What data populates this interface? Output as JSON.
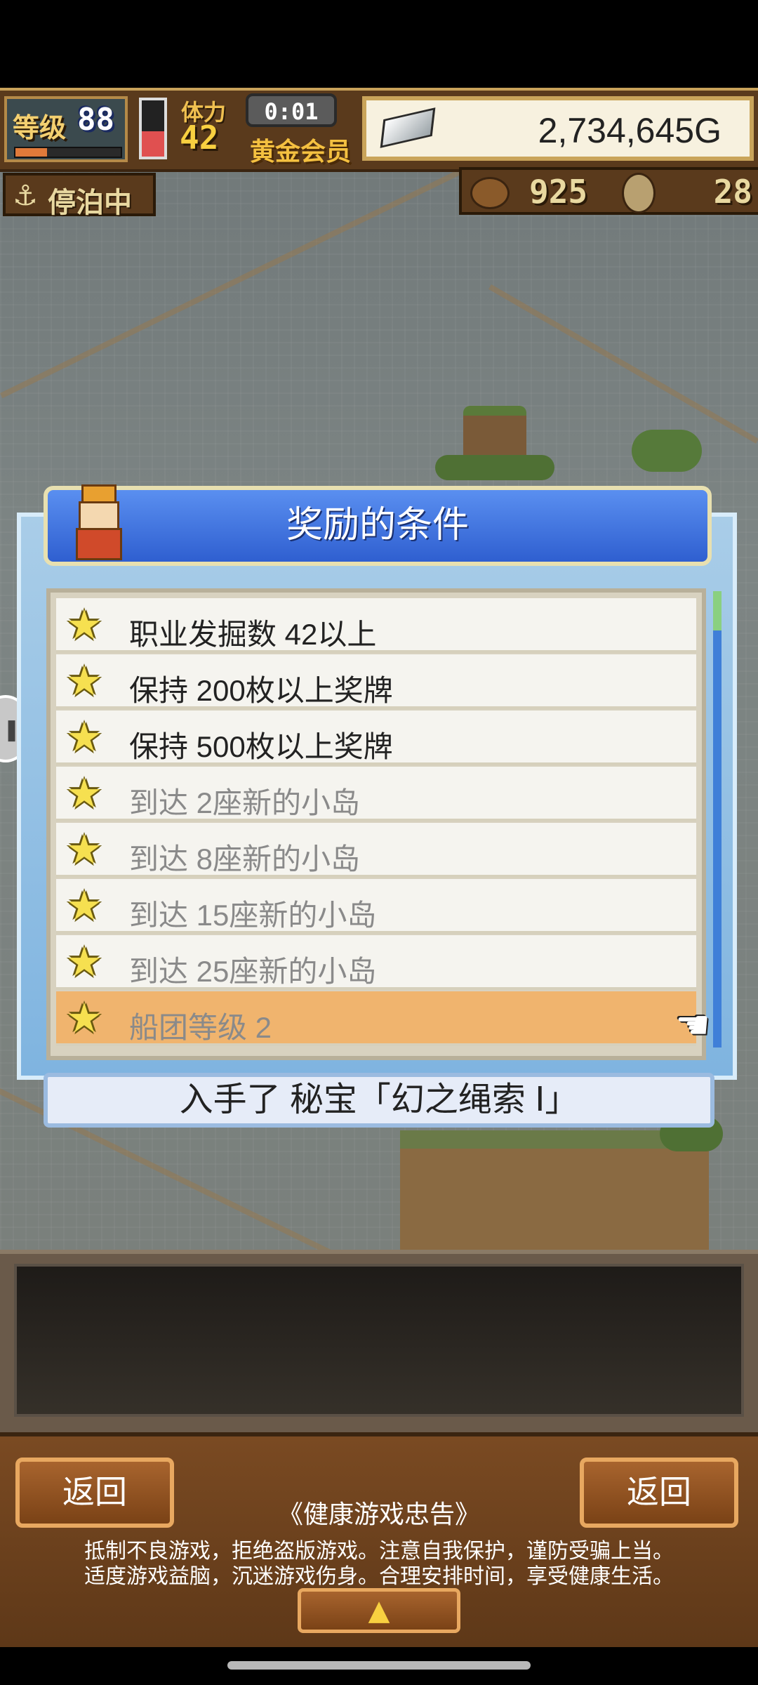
{
  "hud": {
    "level_label": "等级",
    "level_value": "88",
    "level_progress": 0.3,
    "stamina_label": "体力",
    "stamina_value": "42",
    "stamina_fill": 0.45,
    "timer": "0:01",
    "membership": "黄金会员",
    "gold": "2,734,645G"
  },
  "status": {
    "moored_label": "停泊中",
    "resource1_value": "925",
    "resource2_value": "28"
  },
  "dialog": {
    "title": "奖励的条件",
    "conditions": [
      {
        "text": "职业发掘数 42以上",
        "completed": true
      },
      {
        "text": "保持 200枚以上奖牌",
        "completed": true
      },
      {
        "text": "保持 500枚以上奖牌",
        "completed": true
      },
      {
        "text": "到达 2座新的小岛",
        "completed": false
      },
      {
        "text": "到达 8座新的小岛",
        "completed": false
      },
      {
        "text": "到达 15座新的小岛",
        "completed": false
      },
      {
        "text": "到达 25座新的小岛",
        "completed": false
      },
      {
        "text": "船团等级 2",
        "completed": false,
        "selected": true
      }
    ],
    "reward": "入手了 秘宝「幻之绳索 Ⅰ」"
  },
  "bottom": {
    "back_left": "返回",
    "back_right": "返回",
    "advisory_title": "《健康游戏忠告》",
    "advisory_line1": "抵制不良游戏，拒绝盗版游戏。注意自我保护，谨防受骗上当。",
    "advisory_line2": "适度游戏益脑，沉迷游戏伤身。合理安排时间，享受健康生活。"
  },
  "icons": {
    "star": "star-icon",
    "anchor": "anchor-icon",
    "pointer": "hand-pointer-icon",
    "expand": "up-arrow-icon"
  },
  "colors": {
    "header_blue": "#2f5fd0",
    "selected_row": "#f0b46e",
    "wood": "#7a4a22"
  }
}
